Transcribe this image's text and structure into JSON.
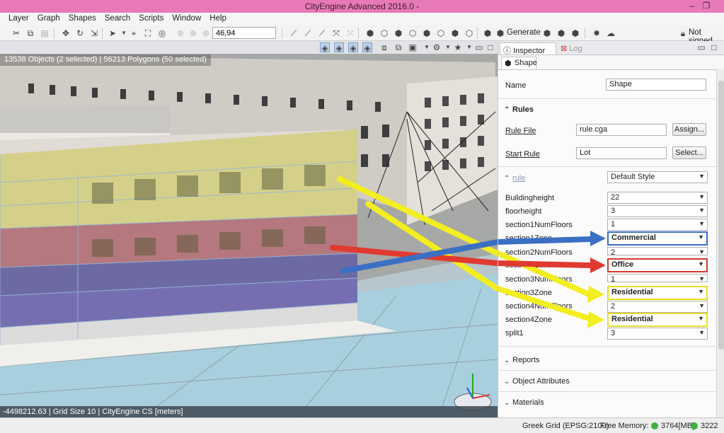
{
  "window": {
    "title": "CityEngine Advanced 2016.0 -",
    "minimize": "–",
    "restore": "❐"
  },
  "menu": [
    "Layer",
    "Graph",
    "Shapes",
    "Search",
    "Scripts",
    "Window",
    "Help"
  ],
  "toolbar": {
    "coord_value": "46,94",
    "generate_label": "Generate",
    "not_signed_label": "Not signed"
  },
  "viewport": {
    "status": "13538 Objects  (2 selected)   |   56213 Polygons  (50 selected)",
    "bottom_status": "-4498212.63  |  Grid Size 10  |  CityEngine CS [meters]"
  },
  "inspector": {
    "tab_inspector": "Inspector",
    "tab_log": "Log",
    "shape_tab": "Shape",
    "name_label": "Name",
    "name_value": "Shape",
    "rules_header": "Rules",
    "rule_file_label": "Rule File",
    "rule_file_value": "rule.cga",
    "assign_button": "Assign...",
    "start_rule_label": "Start Rule",
    "start_rule_value": "Lot",
    "select_button": "Select...",
    "rule_label": "rule",
    "rule_style": "Default Style",
    "attributes": [
      {
        "name": "Buildingheight",
        "value": "22"
      },
      {
        "name": "floorheight",
        "value": "3"
      },
      {
        "name": "section1NumFloors",
        "value": "1"
      },
      {
        "name": "section1Zone",
        "value": "Commercial"
      },
      {
        "name": "section2NumFloors",
        "value": "2"
      },
      {
        "name": "section2Zone",
        "value": "Office"
      },
      {
        "name": "section3NumFloors",
        "value": "1"
      },
      {
        "name": "section3Zone",
        "value": "Residential"
      },
      {
        "name": "section4NumFloors",
        "value": "2"
      },
      {
        "name": "section4Zone",
        "value": "Residential"
      },
      {
        "name": "split1",
        "value": "3"
      }
    ],
    "reports_header": "Reports",
    "object_attributes_header": "Object Attributes",
    "materials_header": "Materials"
  },
  "statusbar": {
    "grid": "Greek Grid (EPSG:2100)",
    "free_memory_label": "Free Memory:",
    "memory_value": "3764[MB]",
    "memory_value2": "3222"
  },
  "colors": {
    "title_bar": "#e879b8",
    "highlight_blue": "#3b6fc4",
    "highlight_red": "#d13c33",
    "highlight_yellow": "#e8e020"
  }
}
